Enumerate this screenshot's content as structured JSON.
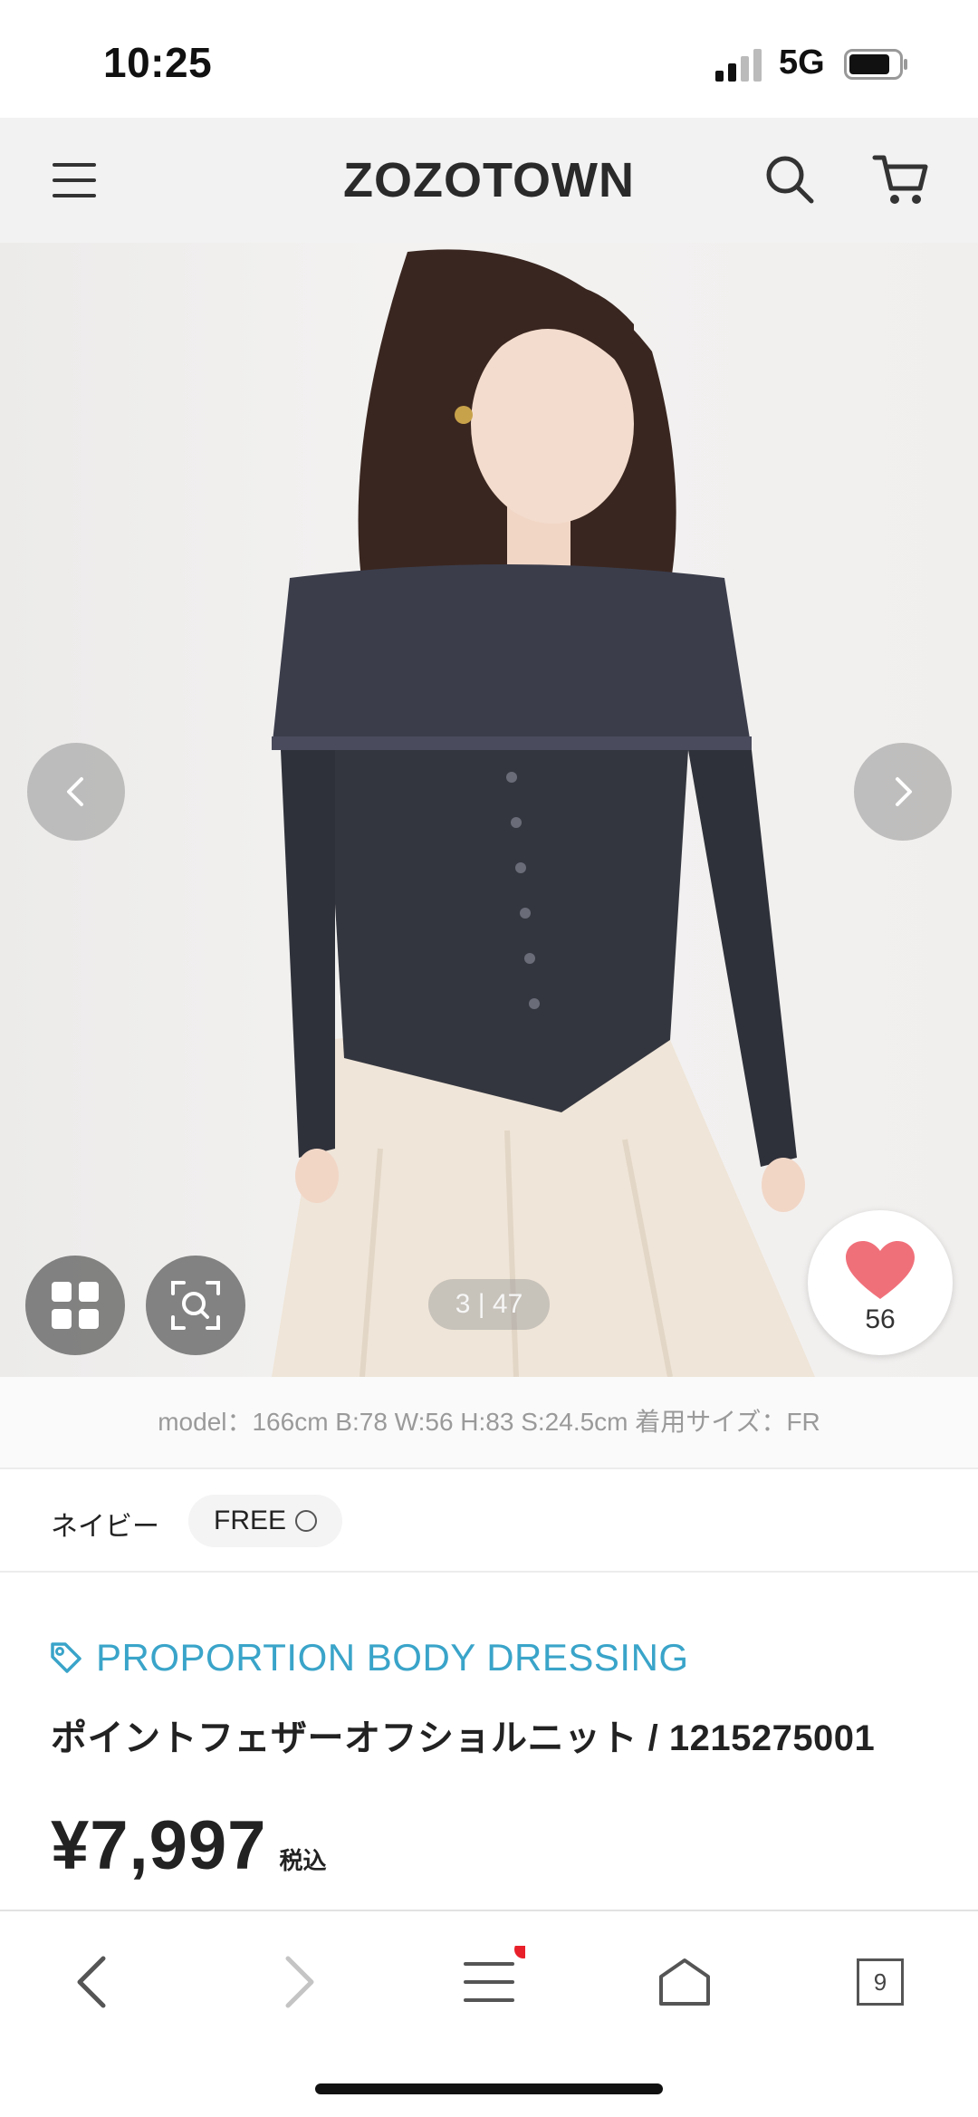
{
  "status_bar": {
    "time": "10:25",
    "network": "5G"
  },
  "header": {
    "logo": "ZOZOTOWN",
    "icons": [
      "menu-icon",
      "search-icon",
      "cart-icon"
    ]
  },
  "gallery": {
    "counter": "3 | 47",
    "favorites_count": "56",
    "icons": [
      "chevron-left-icon",
      "chevron-right-icon",
      "grid-icon",
      "zoom-search-icon",
      "heart-icon"
    ]
  },
  "model_info": "model：166cm B:78 W:56 H:83 S:24.5cm 着用サイズ：FR",
  "variant": {
    "color": "ネイビー",
    "size": "FREE"
  },
  "product": {
    "brand": "PROPORTION BODY DRESSING",
    "title": "ポイントフェザーオフショルニット / 1215275001",
    "price": "¥7,997",
    "tax_label": "税込"
  },
  "bottom_bar": {
    "tabs_count": "9"
  },
  "colors": {
    "brand_accent": "#3aa4c9",
    "heart": "#f0707a",
    "notification_dot": "#e8202a"
  }
}
